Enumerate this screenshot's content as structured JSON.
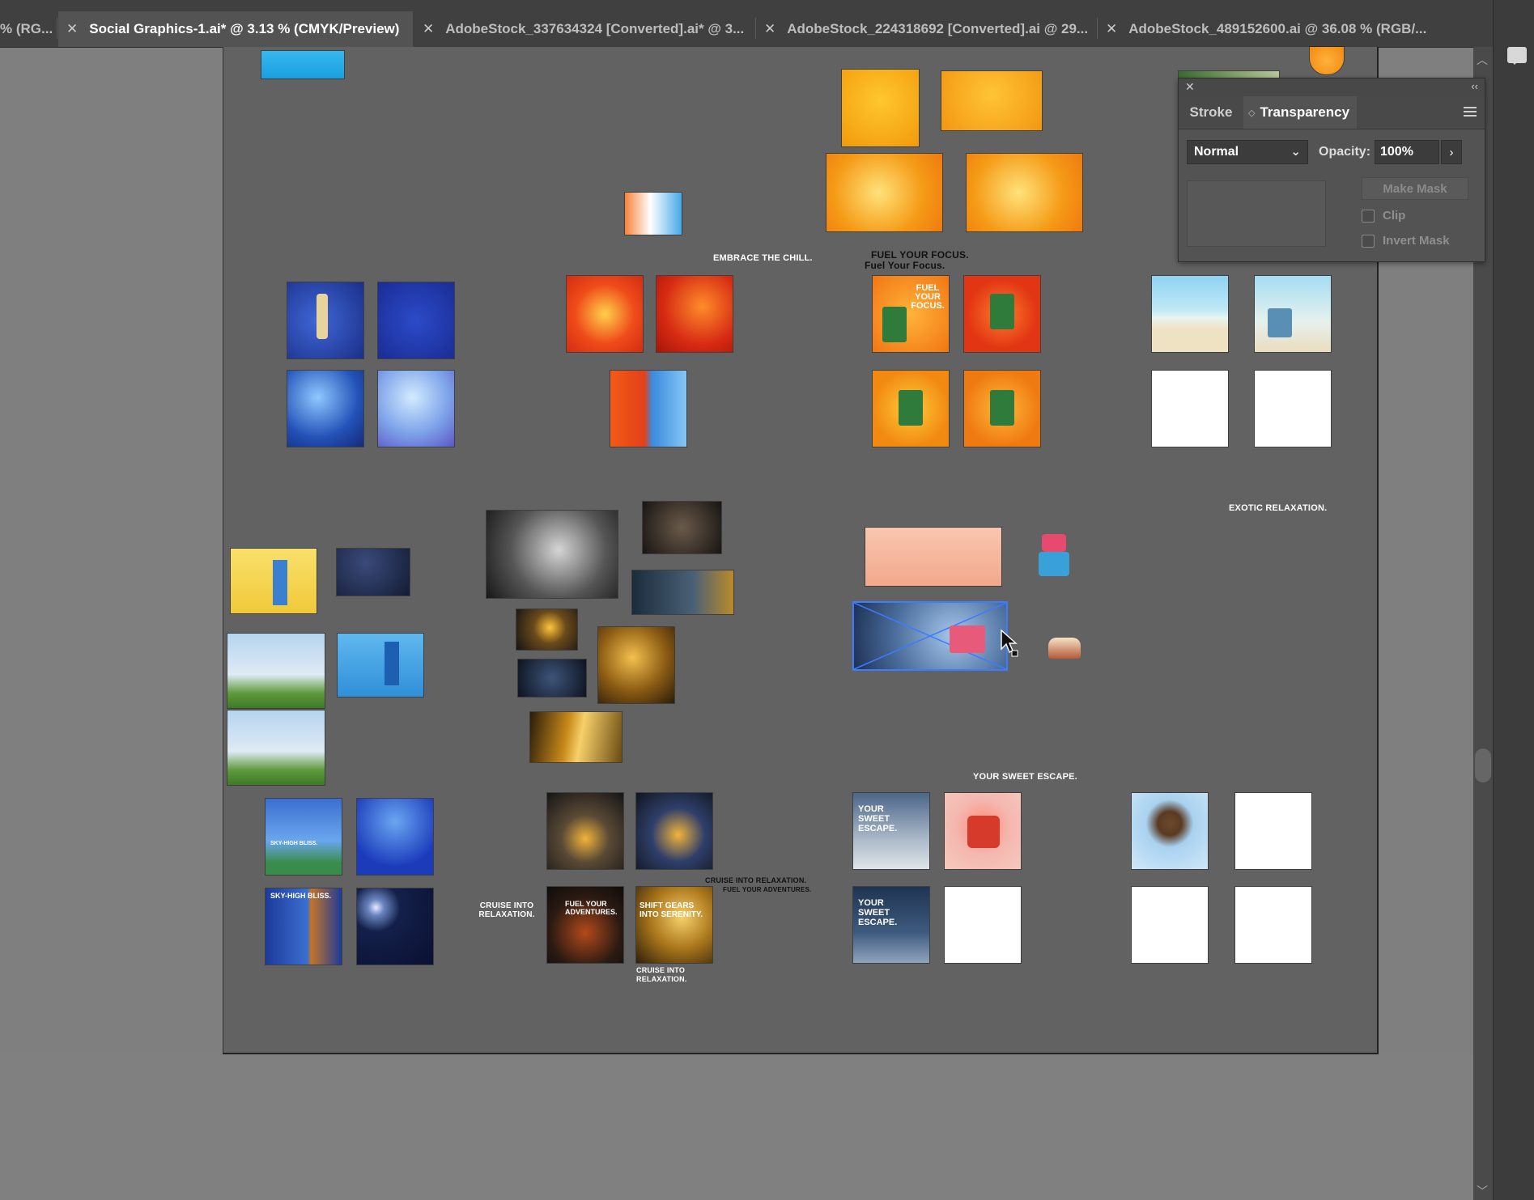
{
  "tabs": [
    {
      "label": "% (RG...",
      "active": false
    },
    {
      "label": "Social Graphics-1.ai* @ 3.13 % (CMYK/Preview)",
      "active": true
    },
    {
      "label": "AdobeStock_337634324 [Converted].ai* @ 3...",
      "active": false
    },
    {
      "label": "AdobeStock_224318692 [Converted].ai @ 29...",
      "active": false
    },
    {
      "label": "AdobeStock_489152600.ai @ 36.08 % (RGB/...",
      "active": false
    }
  ],
  "close_glyph": "✕",
  "panel": {
    "tab_stroke": "Stroke",
    "tab_transparency": "Transparency",
    "blend_mode": "Normal",
    "opacity_label": "Opacity:",
    "opacity_value": "100%",
    "make_mask": "Make Mask",
    "clip": "Clip",
    "invert_mask": "Invert Mask"
  },
  "artboard_labels": {
    "embrace": "EMBRACE THE CHILL.",
    "fuel_focus_1": "FUEL YOUR FOCUS.",
    "fuel_focus_2": "Fuel Your Focus.",
    "exotic": "EXOTIC RELAXATION.",
    "sweet_escape": "YOUR SWEET ESCAPE.",
    "cruise_left": "CRUISE INTO RELAXATION.",
    "cruise_right_1": "CRUISE INTO RELAXATION.",
    "cruise_right_2": "FUEL YOUR ADVENTURES.",
    "cruise_bottom": "CRUISE INTO RELAXATION."
  },
  "thumb_captions": {
    "fuel_focus": "FUEL YOUR FOCUS.",
    "sky_high_1": "SKY-HIGH BLISS.",
    "sky_high_2": "SKY-HIGH BLISS.",
    "fuel_adventures": "FUEL YOUR ADVENTURES.",
    "shift_gears": "SHIFT GEARS INTO SERENITY.",
    "sweet_escape_1": "YOUR SWEET ESCAPE.",
    "sweet_escape_2": "YOUR SWEET ESCAPE."
  },
  "icons": {
    "tab_close": "close-icon",
    "panel_close": "close-icon",
    "panel_collapse": "collapse-icon",
    "panel_menu": "menu-icon",
    "comments": "comment-icon",
    "select_chevron": "chevron-down-icon",
    "opacity_arrow": "chevron-right-icon",
    "cursor": "arrow-cursor-icon"
  },
  "colors": {
    "tabbar_bg": "#404040",
    "canvas_bg": "#7f7f7f",
    "artboard_bg": "#626262",
    "panel_bg": "#535353",
    "selection": "#3d7bff"
  }
}
